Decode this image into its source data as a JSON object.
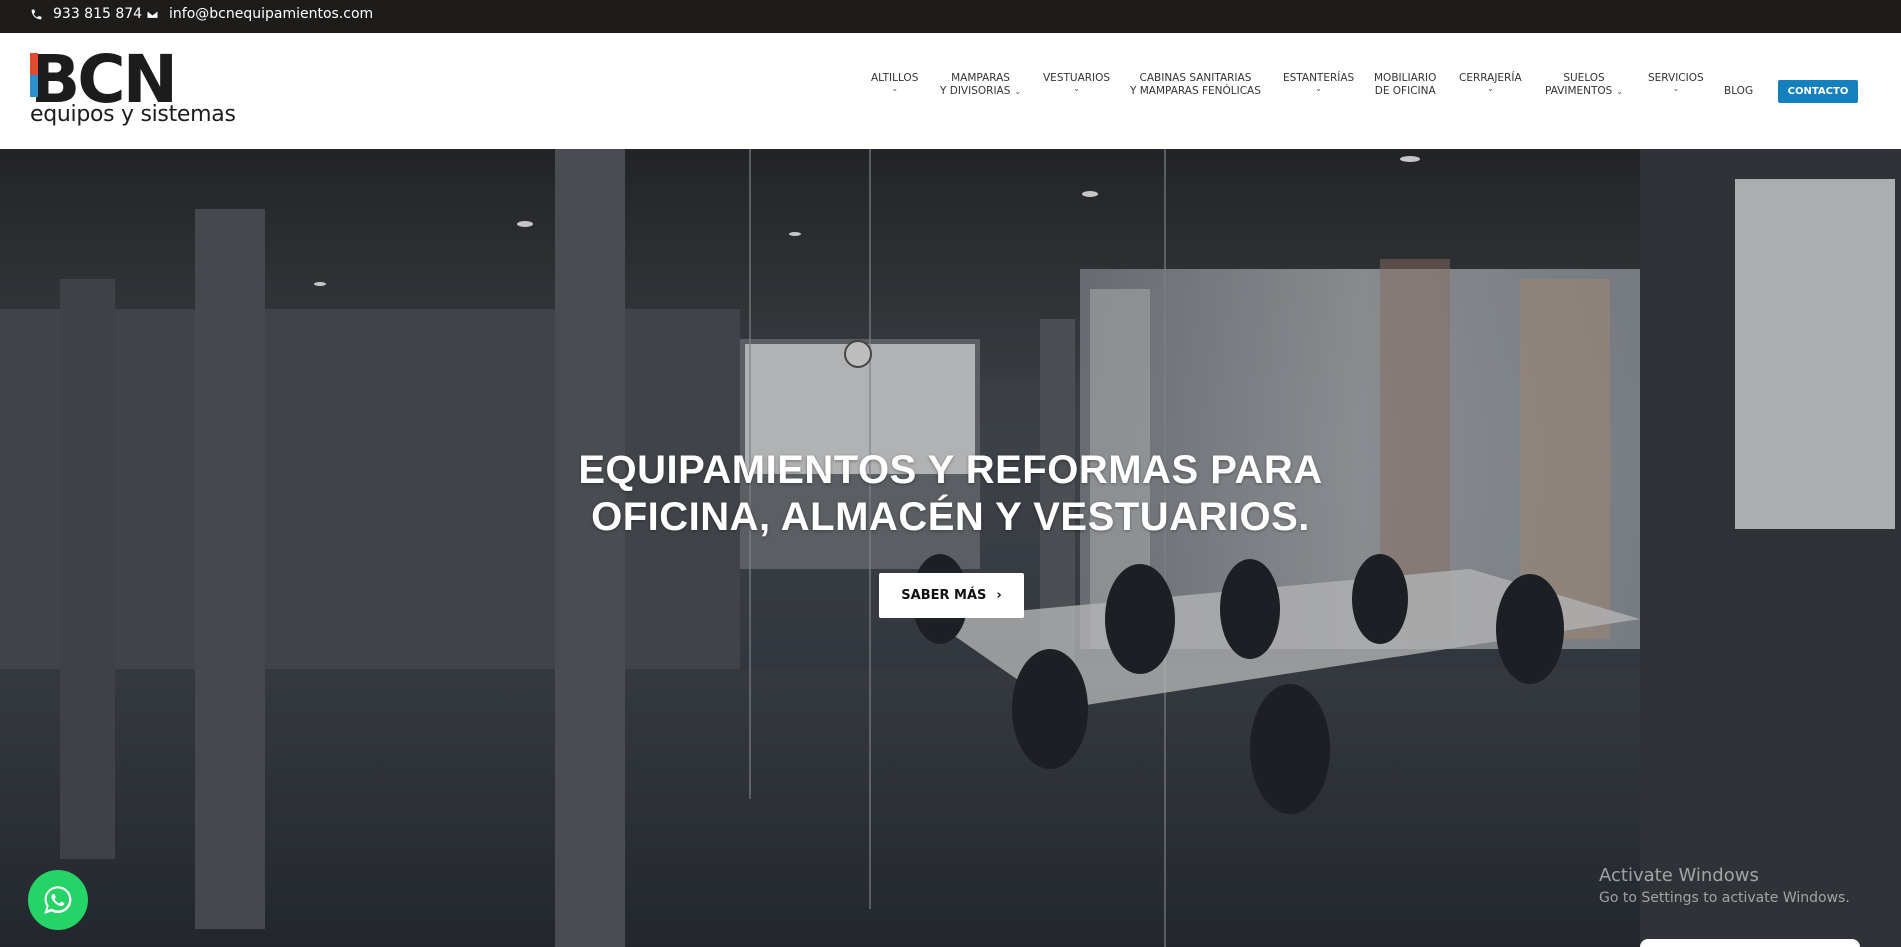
{
  "topbar": {
    "phone": "933 815 874",
    "email": "info@bcnequipamientos.com",
    "phone_icon": "phone-icon",
    "email_icon": "envelope-icon"
  },
  "logo": {
    "brand": "BCN",
    "tagline": "equipos y sistemas"
  },
  "nav": {
    "altillos": "ALTILLOS",
    "mamparas_1": "MAMPARAS",
    "mamparas_2": "Y DIVISORIAS",
    "vestuarios": "VESTUARIOS",
    "cabinas_1": "CABINAS SANITARIAS",
    "cabinas_2": "Y MAMPARAS FENÓLICAS",
    "estanterias": "ESTANTERÍAS",
    "mobiliario_1": "MOBILIARIO",
    "mobiliario_2": "DE OFICINA",
    "cerrajeria": "CERRAJERÍA",
    "suelos_1": "SUELOS",
    "suelos_2": "PAVIMENTOS",
    "servicios": "SERVICIOS",
    "blog": "BLOG",
    "contacto": "CONTACTO"
  },
  "hero": {
    "title_line1": "EQUIPAMIENTOS Y REFORMAS PARA",
    "title_line2": "OFICINA, ALMACÉN Y VESTUARIOS.",
    "cta_label": "SABER MÁS",
    "cta_icon": "chevron-right-icon"
  },
  "windows_watermark": {
    "line1": "Activate Windows",
    "line2": "Go to Settings to activate Windows."
  },
  "colors": {
    "topbar_bg": "#1d1c1a",
    "accent": "#1480bd",
    "whatsapp": "#25d366",
    "logo_red": "#e24a2c",
    "logo_blue": "#2b8fd0"
  }
}
